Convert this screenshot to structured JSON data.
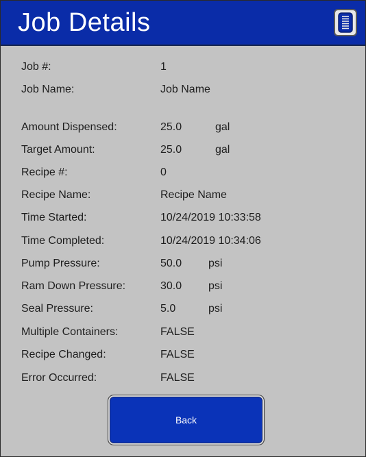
{
  "header": {
    "title": "Job Details",
    "menu_icon": "list-icon"
  },
  "fields": [
    {
      "label": "Job #:",
      "value": "1",
      "unit": ""
    },
    {
      "label": "Job Name:",
      "value": "Job Name",
      "unit": ""
    },
    {
      "label": "Amount Dispensed:",
      "value": "25.0",
      "unit": "gal"
    },
    {
      "label": "Target Amount:",
      "value": "25.0",
      "unit": "gal"
    },
    {
      "label": "Recipe #:",
      "value": "0",
      "unit": ""
    },
    {
      "label": "Recipe Name:",
      "value": "Recipe Name",
      "unit": ""
    },
    {
      "label": "Time Started:",
      "value": "10/24/2019 10:33:58",
      "unit": ""
    },
    {
      "label": "Time Completed:",
      "value": "10/24/2019 10:34:06",
      "unit": ""
    },
    {
      "label": "Pump Pressure:",
      "value": "50.0",
      "unit": "psi"
    },
    {
      "label": "Ram Down Pressure:",
      "value": "30.0",
      "unit": "psi"
    },
    {
      "label": "Seal Pressure:",
      "value": "5.0",
      "unit": "psi"
    },
    {
      "label": "Multiple Containers:",
      "value": "FALSE",
      "unit": ""
    },
    {
      "label": "Recipe Changed:",
      "value": "FALSE",
      "unit": ""
    },
    {
      "label": "Error Occurred:",
      "value": "FALSE",
      "unit": ""
    }
  ],
  "back_button": {
    "label": "Back"
  },
  "colors": {
    "header_bg": "#0a2ca8",
    "body_bg": "#c3c3c3",
    "button_bg": "#0a33b8"
  }
}
